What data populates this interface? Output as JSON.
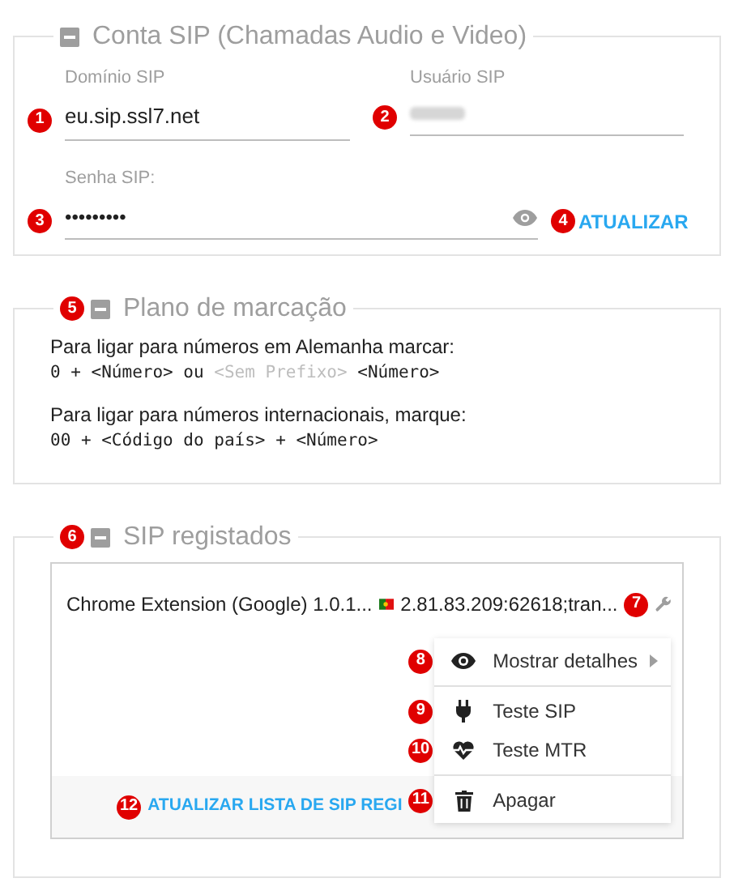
{
  "sip_account": {
    "title": "Conta SIP (Chamadas Audio e Video)",
    "domain": {
      "label": "Domínio SIP",
      "value": "eu.sip.ssl7.net",
      "marker": "1"
    },
    "user": {
      "label": "Usuário SIP",
      "marker": "2"
    },
    "password": {
      "label": "Senha SIP:",
      "value": "•••••••••",
      "marker": "3"
    },
    "update_button": {
      "label": "ATUALIZAR",
      "marker": "4"
    }
  },
  "dial_plan": {
    "title": "Plano de marcação",
    "marker": "5",
    "lines": [
      {
        "kind": "text",
        "parts": [
          {
            "text": "Para ligar para números em Alemanha marcar:",
            "muted": false
          }
        ]
      },
      {
        "kind": "code",
        "parts": [
          {
            "text": "0 + <Número> ou",
            "muted": false
          },
          {
            "text": "<Sem Prefixo>",
            "muted": true
          },
          {
            "text": "<Número>",
            "muted": false
          }
        ]
      },
      {
        "kind": "text",
        "parts": [
          {
            "text": "Para ligar para números internacionais, marque:",
            "muted": false
          }
        ]
      },
      {
        "kind": "code",
        "parts": [
          {
            "text": "00 + <Código do país> + <Número>",
            "muted": false
          }
        ]
      }
    ]
  },
  "registered": {
    "title": "SIP registados",
    "marker": "6",
    "devices": [
      {
        "name": "Chrome Extension (Google) 1.0.1...",
        "address": "2.81.83.209:62618;tran...",
        "tools_marker": "7"
      }
    ],
    "menu": [
      {
        "kind": "details",
        "label": "Mostrar detalhes",
        "submenu": true,
        "marker": "8"
      },
      {
        "kind": "divider"
      },
      {
        "kind": "sip_test",
        "label": "Teste SIP",
        "submenu": false,
        "marker": "9"
      },
      {
        "kind": "mtr_test",
        "label": "Teste MTR",
        "submenu": false,
        "marker": "10"
      },
      {
        "kind": "divider"
      },
      {
        "kind": "delete",
        "label": "Apagar",
        "submenu": false,
        "marker": "11"
      }
    ],
    "refresh_link": {
      "label": "ATUALIZAR LISTA DE SIP REGI",
      "marker": "12"
    }
  }
}
